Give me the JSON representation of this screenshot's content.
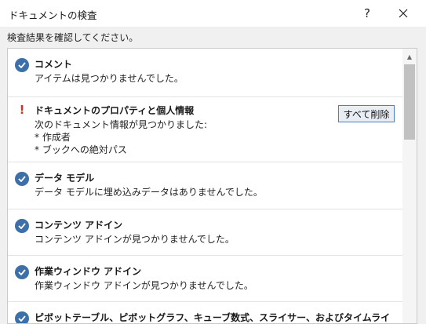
{
  "window": {
    "title": "ドキュメントの検査",
    "help_label": "?"
  },
  "subtitle": "検査結果を確認してください。",
  "results": [
    {
      "status": "check",
      "name": "コメント",
      "lines": [
        "アイテムは見つかりませんでした。"
      ]
    },
    {
      "status": "warning",
      "name": "ドキュメントのプロパティと個人情報",
      "lines": [
        "次のドキュメント情報が見つかりました:",
        "* 作成者",
        "* ブックへの絶対パス"
      ],
      "button_label": "すべて削除"
    },
    {
      "status": "check",
      "name": "データ モデル",
      "lines": [
        "データ モデルに埋め込みデータはありませんでした。"
      ]
    },
    {
      "status": "check",
      "name": "コンテンツ アドイン",
      "lines": [
        "コンテンツ アドインが見つかりませんでした。"
      ]
    },
    {
      "status": "check",
      "name": "作業ウィンドウ アドイン",
      "lines": [
        "作業ウィンドウ アドインが見つかりませんでした。"
      ]
    },
    {
      "status": "check",
      "name": "ピボットテーブル、ピボットグラフ、キューブ数式、スライサー、およびタイムライ",
      "lines": []
    }
  ],
  "colors": {
    "check": "#3d6fa8",
    "warning": "#c0392b",
    "button_border": "#4a7fc0"
  },
  "icons": {
    "check": "check-circle-icon",
    "warning": "exclamation-icon",
    "close": "close-icon",
    "help": "help-icon",
    "scroll_up": "chevron-up-icon"
  }
}
